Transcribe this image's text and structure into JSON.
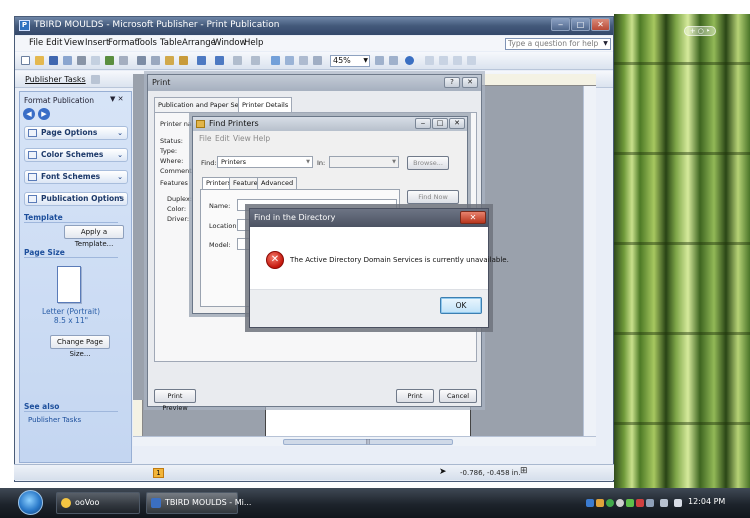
{
  "desktop": {
    "hint": "+ ○ ‣"
  },
  "app": {
    "title": "TBIRD MOULDS - Microsoft Publisher - Print Publication",
    "menus": [
      "File",
      "Edit",
      "View",
      "Insert",
      "Format",
      "Tools",
      "Table",
      "Arrange",
      "Window",
      "Help"
    ],
    "help_search_placeholder": "Type a question for help",
    "zoom": "45%",
    "publisher_tasks_button": "Publisher Tasks"
  },
  "taskpane": {
    "header": "Format Publication",
    "sections": [
      "Page Options",
      "Color Schemes",
      "Font Schemes",
      "Publication Options"
    ],
    "template_label": "Template",
    "apply_template_button": "Apply a Template...",
    "page_size_label": "Page Size",
    "page_size_line1": "Letter (Portrait)",
    "page_size_line2": "8.5 x 11\"",
    "change_page_size_button": "Change Page Size...",
    "see_also_label": "See also",
    "publisher_tasks_link": "Publisher Tasks"
  },
  "print_dialog": {
    "title": "Print",
    "tabs": [
      "Publication and Paper Settings",
      "Printer Details"
    ],
    "printer_name_label": "Printer name",
    "fields": [
      "Status:",
      "Type:",
      "Where:",
      "Comment:",
      "Features"
    ],
    "feature_fields": [
      "Duplex:",
      "Color:",
      "Driver:"
    ],
    "print_preview_button": "Print Preview",
    "print_button": "Print",
    "cancel_button": "Cancel"
  },
  "find_printers": {
    "title": "Find Printers",
    "menus": [
      "File",
      "Edit",
      "View",
      "Help"
    ],
    "find_label": "Find:",
    "find_value": "Printers",
    "in_label": "In:",
    "browse_button": "Browse...",
    "tabs": [
      "Printers",
      "Features",
      "Advanced"
    ],
    "name_label": "Name:",
    "location_label": "Location:",
    "model_label": "Model:",
    "find_now_button": "Find Now"
  },
  "error_dialog": {
    "title": "Find in the Directory",
    "message": "The Active Directory Domain Services is currently unavailable.",
    "ok_button": "OK"
  },
  "statusbar": {
    "page_number": "1",
    "coordinates": "-0.786, -0.458 in."
  },
  "taskbar": {
    "buttons": [
      "ooVoo",
      "TBIRD MOULDS - Mi..."
    ],
    "clock": "12:04 PM"
  }
}
